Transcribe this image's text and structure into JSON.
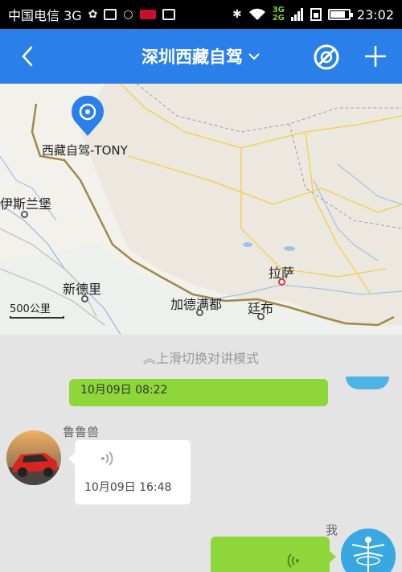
{
  "status_bar": {
    "carrier": "中国电信 3G",
    "time": "23:02",
    "signal_top": "3G",
    "signal_bottom": "2G",
    "battery_level": 0.8
  },
  "header": {
    "title": "深圳西藏自驾",
    "back_icon": "back-arrow-icon",
    "mute_icon": "mute-icon",
    "add_icon": "plus-icon",
    "accent": "#2a80e8"
  },
  "map": {
    "pin_label": "西藏自驾-TONY",
    "places": {
      "yisilanbao": "伊斯兰堡",
      "xindeli": "新德里",
      "jiademandu": "加德满都",
      "lasa": "拉萨",
      "tingbu": "廷布"
    },
    "scale": "500公里"
  },
  "chat": {
    "hint": "上滑切换对讲模式",
    "messages": [
      {
        "side": "right",
        "time": "10月09日  08:22"
      },
      {
        "side": "left",
        "sender": "鲁鲁兽",
        "time": "10月09日  16:48",
        "type": "voice"
      },
      {
        "side": "right",
        "sender": "我",
        "type": "voice"
      }
    ],
    "bubble_color": "#8fd63a"
  }
}
